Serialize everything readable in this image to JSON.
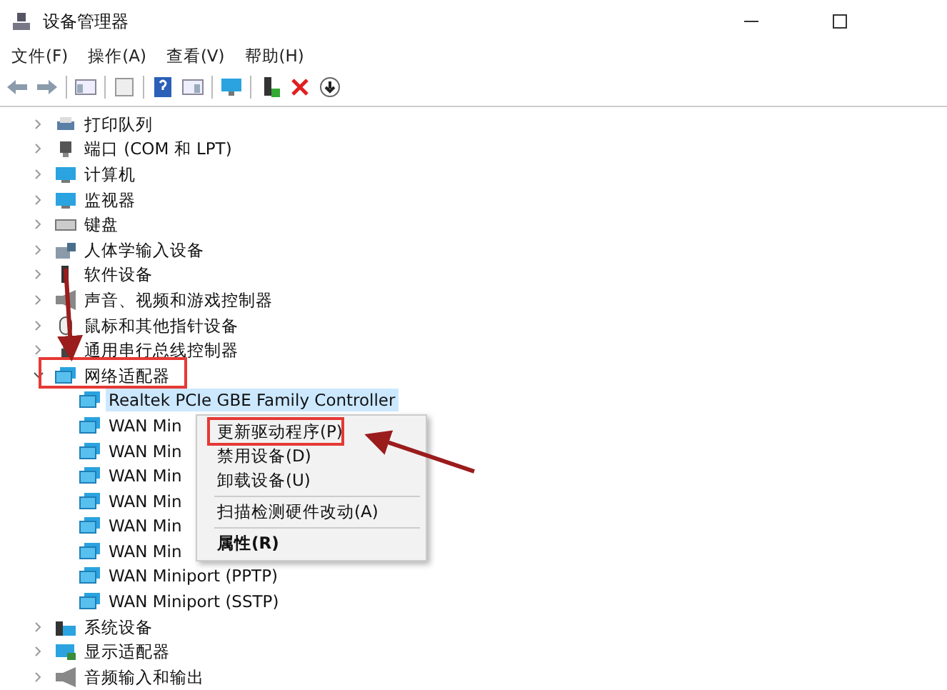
{
  "window": {
    "title": "设备管理器"
  },
  "menu_bar": [
    "文件(F)",
    "操作(A)",
    "查看(V)",
    "帮助(H)"
  ],
  "tree": [
    {
      "label": "打印队列",
      "expanded": false
    },
    {
      "label": "端口 (COM 和 LPT)",
      "expanded": false
    },
    {
      "label": "计算机",
      "expanded": false
    },
    {
      "label": "监视器",
      "expanded": false
    },
    {
      "label": "键盘",
      "expanded": false
    },
    {
      "label": "人体学输入设备",
      "expanded": false
    },
    {
      "label": "软件设备",
      "expanded": false
    },
    {
      "label": "声音、视频和游戏控制器",
      "expanded": false
    },
    {
      "label": "鼠标和其他指针设备",
      "expanded": false
    },
    {
      "label": "通用串行总线控制器",
      "expanded": false
    },
    {
      "label": "网络适配器",
      "expanded": true,
      "children": [
        {
          "label": "Realtek PCIe GBE Family Controller",
          "selected": true
        },
        {
          "label": "WAN Min",
          "selected": false
        },
        {
          "label": "WAN Min",
          "selected": false
        },
        {
          "label": "WAN Min",
          "selected": false
        },
        {
          "label": "WAN Min",
          "selected": false
        },
        {
          "label": "WAN Min",
          "selected": false
        },
        {
          "label": "WAN Min",
          "selected": false
        },
        {
          "label": "WAN Miniport (PPTP)",
          "selected": false
        },
        {
          "label": "WAN Miniport (SSTP)",
          "selected": false
        }
      ]
    },
    {
      "label": "系统设备",
      "expanded": false
    },
    {
      "label": "显示适配器",
      "expanded": false
    },
    {
      "label": "音频输入和输出",
      "expanded": false
    }
  ],
  "context_menu": [
    [
      {
        "label": "更新驱动程序(P)",
        "default": false
      },
      {
        "label": "禁用设备(D)",
        "default": false
      },
      {
        "label": "卸载设备(U)",
        "default": false
      }
    ],
    [
      {
        "label": "扫描检测硬件改动(A)",
        "default": false
      }
    ],
    [
      {
        "label": "属性(R)",
        "default": true
      }
    ]
  ]
}
